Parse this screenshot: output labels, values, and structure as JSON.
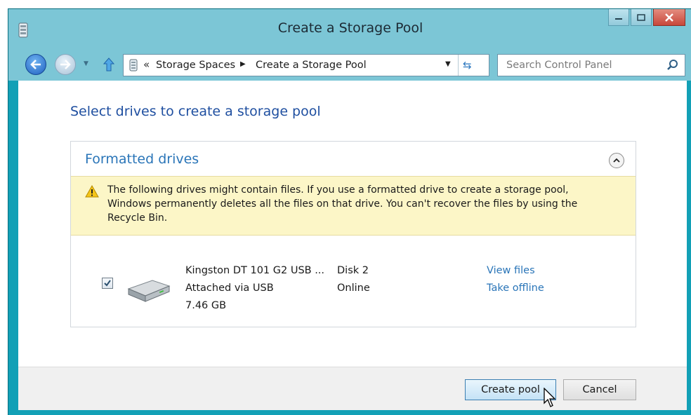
{
  "window": {
    "title": "Create a Storage Pool",
    "accent": "#12a0b6"
  },
  "navigation": {
    "breadcrumb_chevron": "«",
    "breadcrumb": [
      "Storage Spaces",
      "Create a Storage Pool"
    ],
    "search_placeholder": "Search Control Panel"
  },
  "page": {
    "heading": "Select drives to create a storage pool"
  },
  "panel": {
    "title": "Formatted drives",
    "warning": "The following drives might contain files. If you use a formatted drive to create a storage pool, Windows permanently deletes all the files on that drive. You can't recover the files by using the Recycle Bin."
  },
  "drives": [
    {
      "name": "Kingston DT 101 G2 USB ...",
      "connection": "Attached via USB",
      "size": "7.46 GB",
      "disk": "Disk 2",
      "status": "Online",
      "links": [
        "View files",
        "Take offline"
      ],
      "checked": true
    }
  ],
  "footer": {
    "primary_label": "Create pool",
    "cancel_label": "Cancel"
  },
  "icons": {
    "title": "storage-spaces-icon",
    "back": "back-arrow-icon",
    "forward": "forward-arrow-icon",
    "up": "up-arrow-icon",
    "refresh": "refresh-icon",
    "search": "search-icon",
    "warning": "warning-icon",
    "drive": "hard-drive-icon",
    "collapse": "chevron-up-icon",
    "cursor": "mouse-pointer-icon"
  },
  "colors": {
    "heading": "#1f4fa0",
    "link": "#2a75b8",
    "warning_bg": "#fcf6c7"
  }
}
